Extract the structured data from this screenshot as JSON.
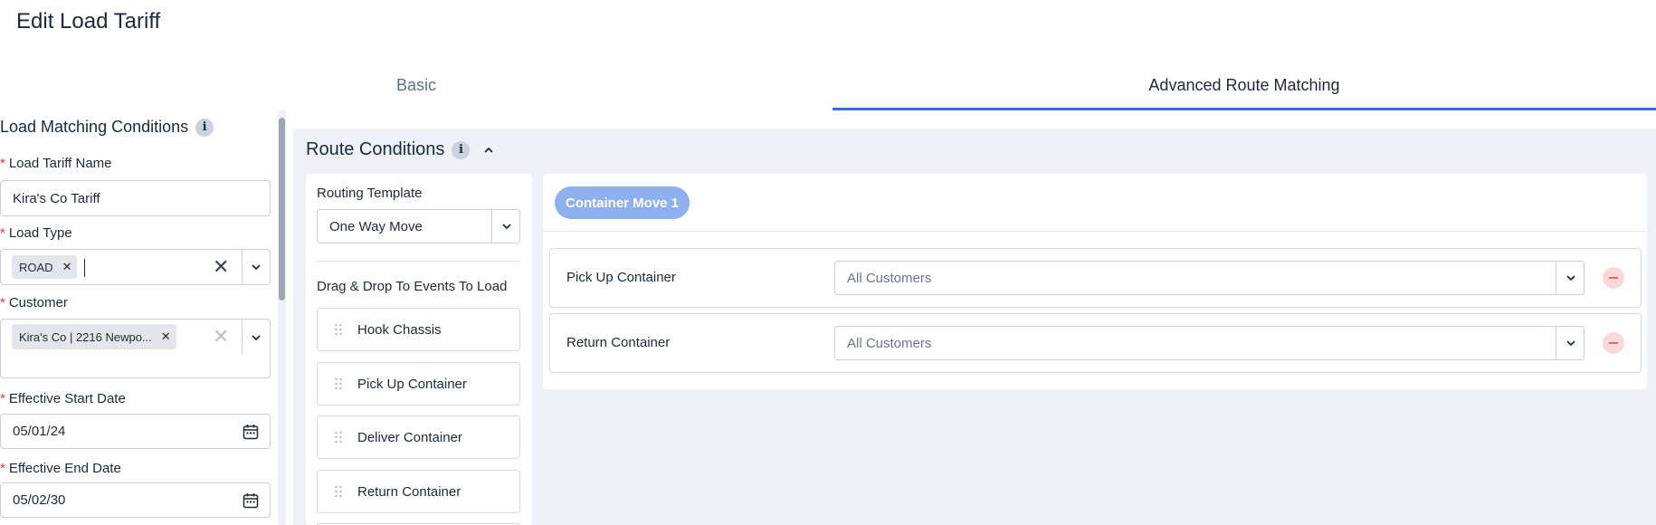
{
  "page": {
    "title": "Edit Load Tariff"
  },
  "tabs": [
    {
      "label": "Basic",
      "active": false
    },
    {
      "label": "Advanced Route Matching",
      "active": true
    }
  ],
  "load_matching": {
    "title": "Load Matching Conditions",
    "tariff_name": {
      "label": "Load Tariff Name",
      "value": "Kira's Co Tariff"
    },
    "load_type": {
      "label": "Load Type",
      "chips": [
        "ROAD"
      ]
    },
    "customer": {
      "label": "Customer",
      "chips": [
        "Kira's Co | 2216 Newpo..."
      ]
    },
    "start_date": {
      "label": "Effective Start Date",
      "value": "05/01/24"
    },
    "end_date": {
      "label": "Effective End Date",
      "value": "05/02/30"
    }
  },
  "route_conditions": {
    "title": "Route Conditions",
    "routing_template": {
      "label": "Routing Template",
      "value": "One Way Move"
    },
    "drag_label": "Drag & Drop To Events To Load",
    "events": [
      "Hook Chassis",
      "Pick Up Container",
      "Deliver Container",
      "Return Container"
    ],
    "move": {
      "label": "Container Move 1",
      "rows": [
        {
          "label": "Pick Up Container",
          "value": "All Customers"
        },
        {
          "label": "Return Container",
          "value": "All Customers"
        }
      ]
    }
  },
  "colors": {
    "accent": "#2f6fe4",
    "pill": "#8fb0ef",
    "panel_bg": "#eef2f6",
    "required": "#e03a3a",
    "remove": "#e26b6b"
  }
}
